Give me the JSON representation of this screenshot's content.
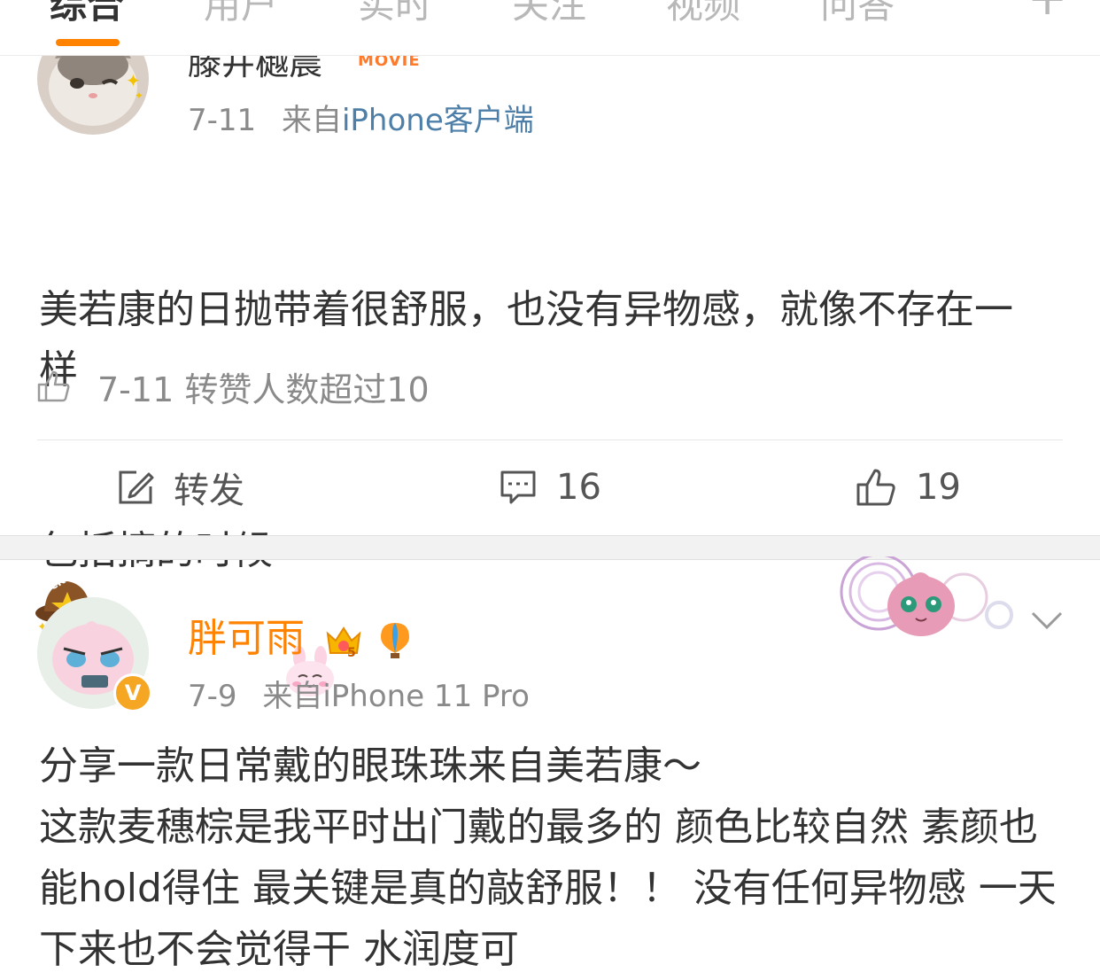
{
  "tabs": [
    {
      "label": "综合",
      "active": true
    },
    {
      "label": "用户",
      "active": false
    },
    {
      "label": "实时",
      "active": false
    },
    {
      "label": "关注",
      "active": false
    },
    {
      "label": "视频",
      "active": false
    },
    {
      "label": "问答",
      "active": false
    }
  ],
  "tab_plus": "+",
  "accent_color": "#ff8200",
  "link_color": "#4d7fa8",
  "post1": {
    "author_partial": "滕井樾晨",
    "badge": "MOVIE",
    "date": "7-11",
    "source_prefix": "来自",
    "source": "iPhone客户端",
    "content_line1": "美若康的日抛带着很舒服，也没有异物感，就像不存在一样",
    "content_line2": "包括摘的时候",
    "like_info": "7-11 转赞人数超过10",
    "repost_label": "转发",
    "comment_count": "16",
    "like_count": "19"
  },
  "post2": {
    "author": "胖可雨",
    "verified_mark": "V",
    "date": "7-9",
    "source_text": "来自iPhone 11 Pro",
    "content": "分享一款日常戴的眼珠珠来自美若康～\n这款麦穗棕是我平时出门戴的最多的 颜色比较自然 素颜也能hold得住 最关键是真的敲舒服！！ 没有任何异物感 一天下来也不会觉得干 水润度可"
  }
}
